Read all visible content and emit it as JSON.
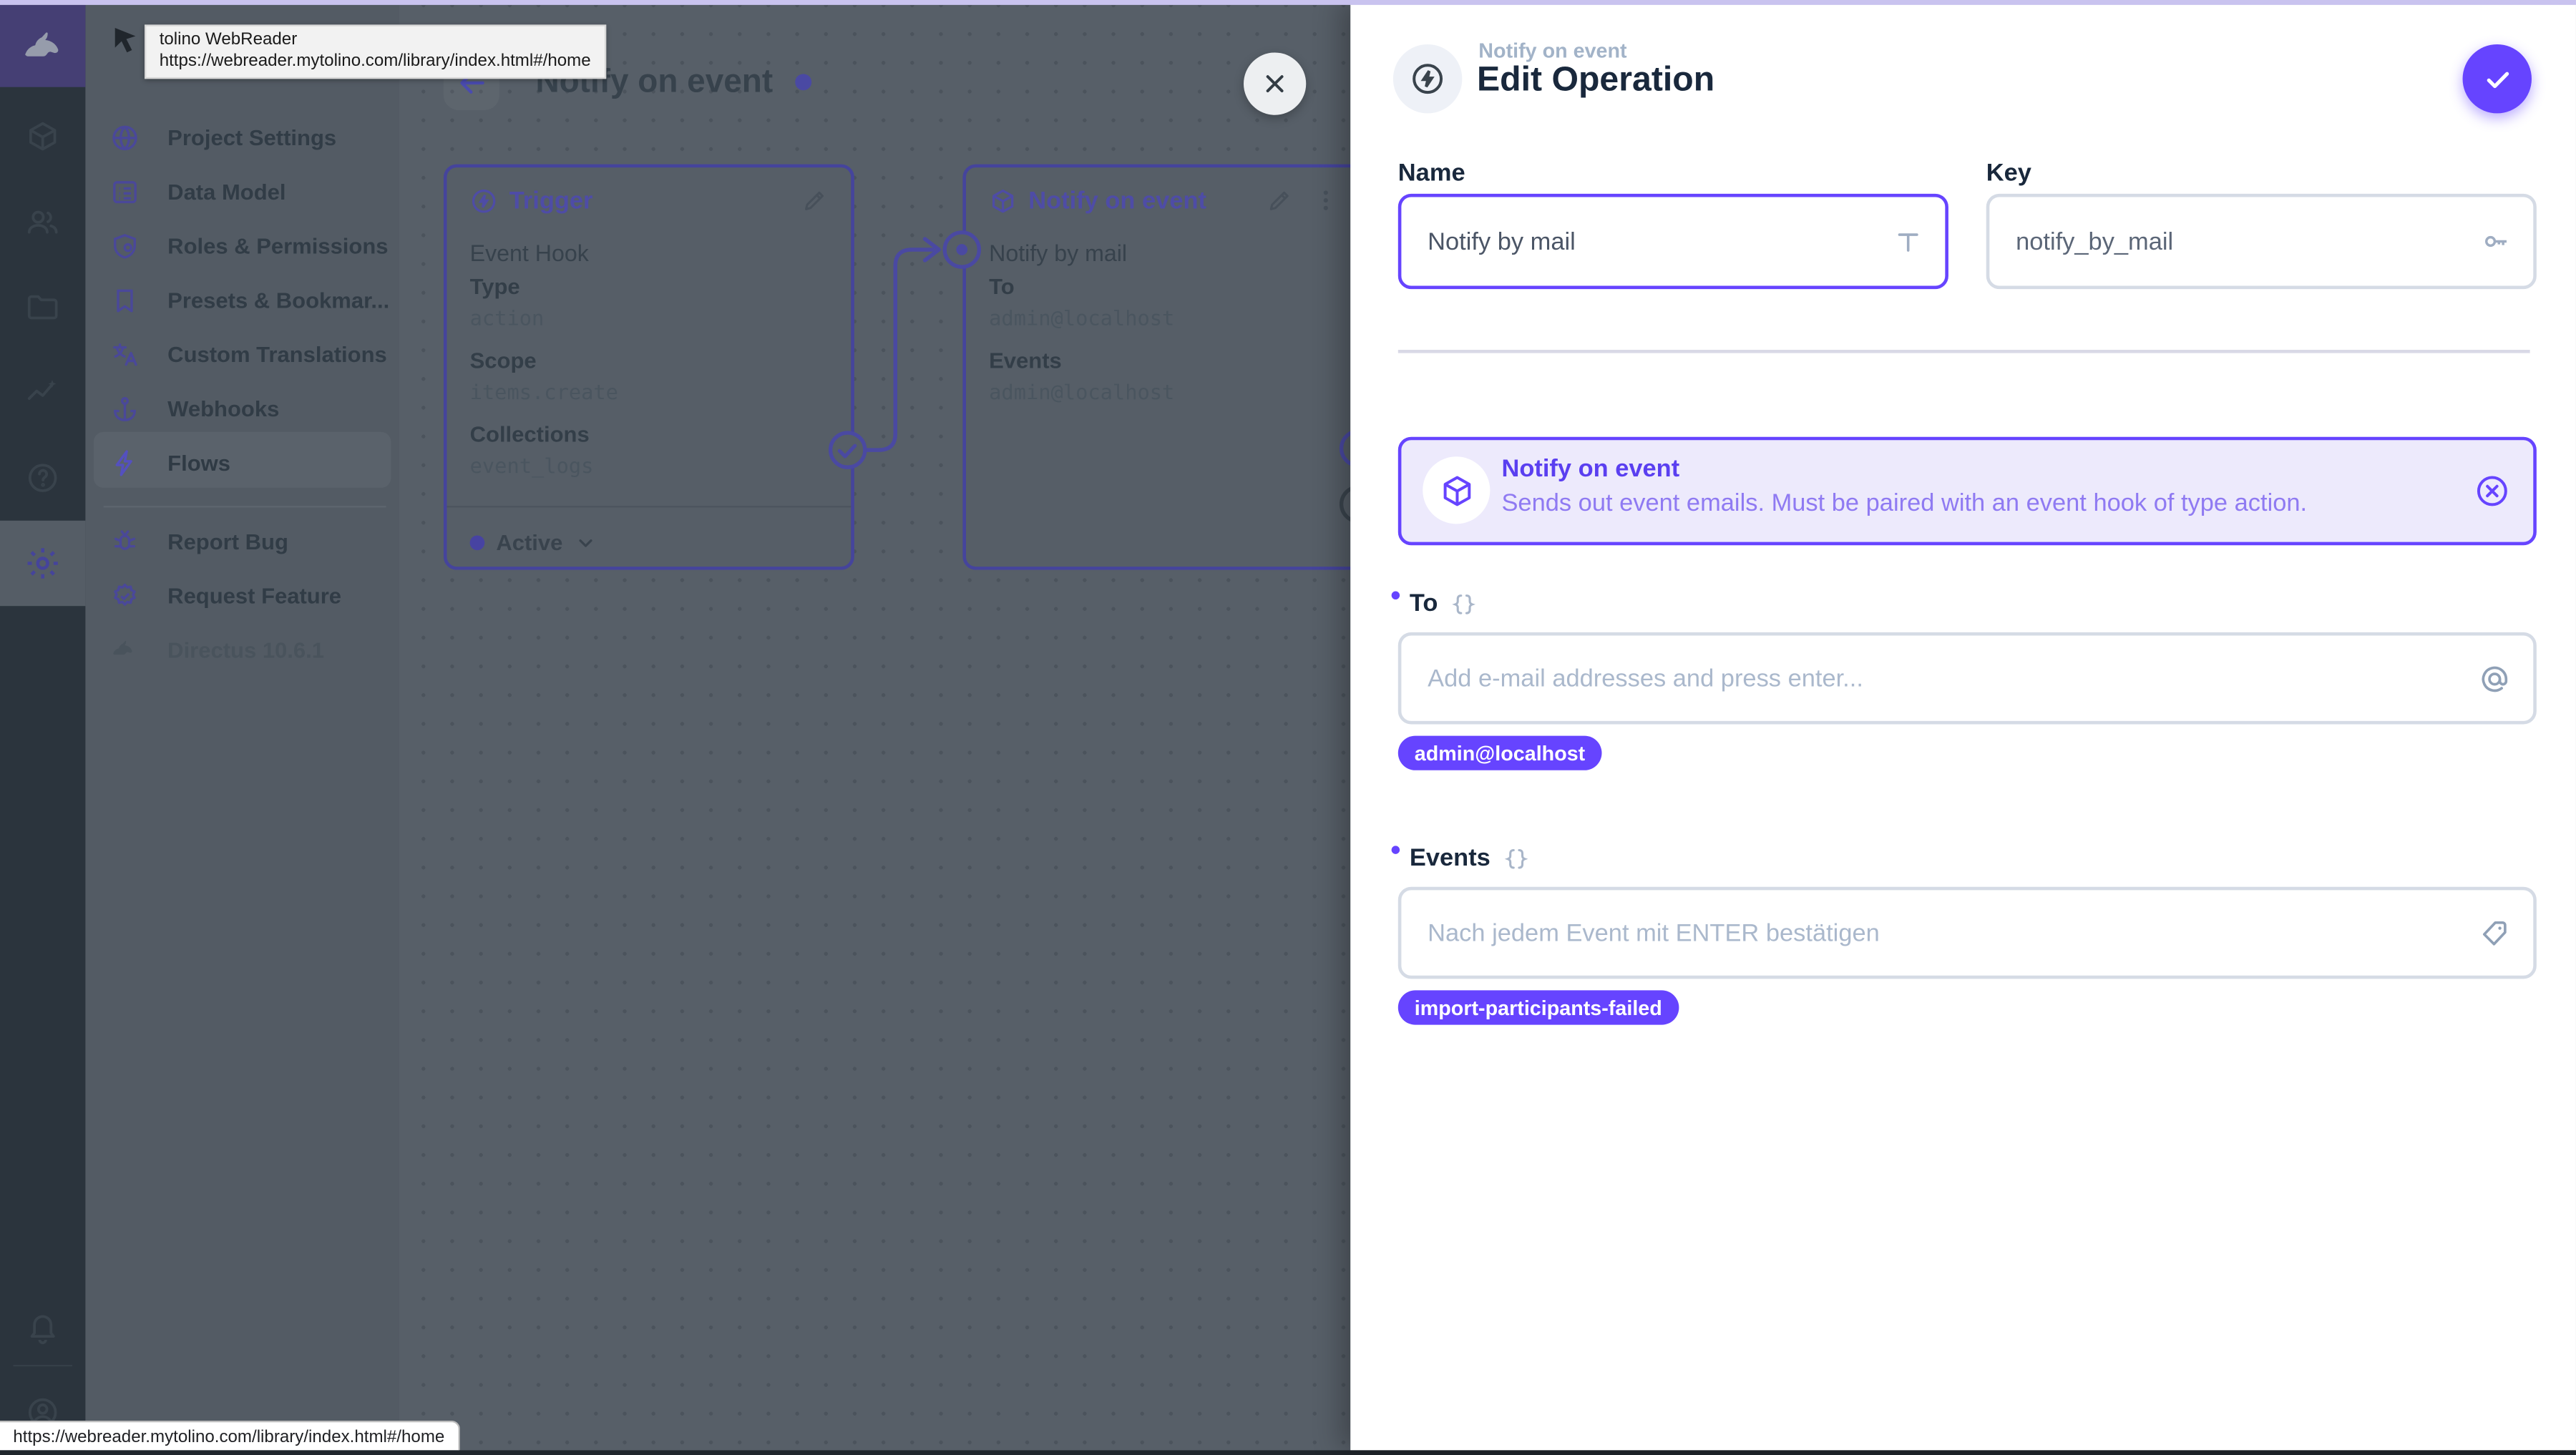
{
  "accent": "#6644ff",
  "browser": {
    "tooltip_title": "tolino WebReader",
    "tooltip_url": "https://webreader.mytolino.com/library/index.html#/home",
    "status_url": "https://webreader.mytolino.com/library/index.html#/home"
  },
  "nav": {
    "items": [
      {
        "label": "Project Settings"
      },
      {
        "label": "Data Model"
      },
      {
        "label": "Roles & Permissions"
      },
      {
        "label": "Presets & Bookmar..."
      },
      {
        "label": "Custom Translations"
      },
      {
        "label": "Webhooks"
      },
      {
        "label": "Flows"
      }
    ],
    "footer_items": [
      {
        "label": "Report Bug"
      },
      {
        "label": "Request Feature"
      }
    ],
    "version": "Directus 10.6.1"
  },
  "canvas": {
    "title": "Notify on event",
    "trigger_panel": {
      "title": "Trigger",
      "subtitle": "Event Hook",
      "fields": [
        {
          "label": "Type",
          "value": "action"
        },
        {
          "label": "Scope",
          "value": "items.create"
        },
        {
          "label": "Collections",
          "value": "event_logs"
        }
      ],
      "status": "Active"
    },
    "operation_panel": {
      "title": "Notify on event",
      "subtitle": "Notify by mail",
      "fields": [
        {
          "label": "To",
          "value": "admin@localhost"
        },
        {
          "label": "Events",
          "value": "admin@localhost"
        }
      ]
    }
  },
  "drawer": {
    "breadcrumb": "Notify on event",
    "title": "Edit Operation",
    "name": {
      "label": "Name",
      "value": "Notify by mail"
    },
    "key": {
      "label": "Key",
      "value": "notify_by_mail"
    },
    "notice": {
      "title": "Notify on event",
      "description": "Sends out event emails. Must be paired with an event hook of type action."
    },
    "to": {
      "label": "To",
      "placeholder": "Add e-mail addresses and press enter...",
      "chips": [
        "admin@localhost"
      ]
    },
    "events": {
      "label": "Events",
      "placeholder": "Nach jedem Event mit ENTER bestätigen",
      "chips": [
        "import-participants-failed"
      ]
    }
  }
}
